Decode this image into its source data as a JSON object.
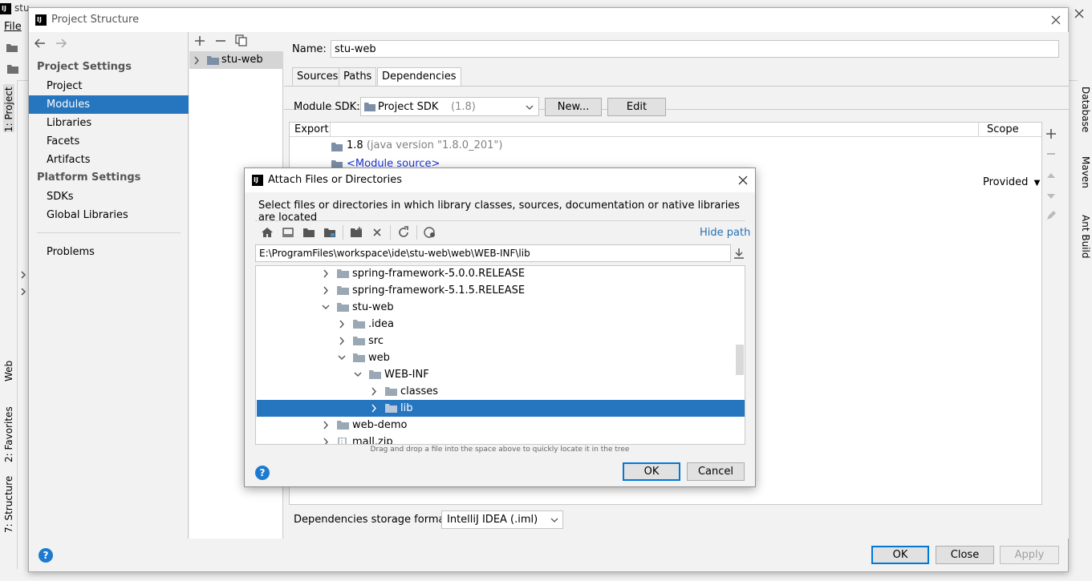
{
  "ide": {
    "title_fragment": "stu",
    "menu_file": "File",
    "left_tabs": [
      "1: Project",
      "Web",
      "2: Favorites",
      "7: Structure"
    ],
    "right_tabs": [
      "Database",
      "Maven",
      "Ant Build"
    ]
  },
  "project_structure": {
    "title": "Project Structure",
    "nav": {
      "project_settings_header": "Project Settings",
      "items_project": [
        "Project",
        "Modules",
        "Libraries",
        "Facets",
        "Artifacts"
      ],
      "platform_settings_header": "Platform Settings",
      "items_platform": [
        "SDKs",
        "Global Libraries"
      ],
      "problems": "Problems",
      "selected": "Modules"
    },
    "module_tree": {
      "item": "stu-web"
    },
    "name_label": "Name:",
    "name_value": "stu-web",
    "tabs": [
      "Sources",
      "Paths",
      "Dependencies"
    ],
    "selected_tab": "Dependencies",
    "module_sdk_label": "Module SDK:",
    "module_sdk_value": "Project SDK",
    "module_sdk_version": "(1.8)",
    "new_button": "New...",
    "edit_button": "Edit",
    "table": {
      "col_export": "Export",
      "col_scope": "Scope",
      "rows": [
        {
          "name": "1.8",
          "detail": "(java version \"1.8.0_201\")"
        },
        {
          "name": "<Module source>",
          "detail": ""
        }
      ],
      "scope_value": "Provided"
    },
    "storage_label": "Dependencies storage format:",
    "storage_value": "IntelliJ IDEA (.iml)",
    "ok": "OK",
    "close": "Close",
    "apply": "Apply"
  },
  "attach_dialog": {
    "title": "Attach Files or Directories",
    "description": "Select files or directories in which library classes, sources, documentation or native libraries are located",
    "hide_path": "Hide path",
    "path": "E:\\ProgramFiles\\workspace\\ide\\stu-web\\web\\WEB-INF\\lib",
    "tree": [
      {
        "label": "spring-framework-5.0.0.RELEASE",
        "depth": 0,
        "expanded": false,
        "type": "folder"
      },
      {
        "label": "spring-framework-5.1.5.RELEASE",
        "depth": 0,
        "expanded": false,
        "type": "folder"
      },
      {
        "label": "stu-web",
        "depth": 0,
        "expanded": true,
        "type": "folder"
      },
      {
        "label": ".idea",
        "depth": 1,
        "expanded": false,
        "type": "folder"
      },
      {
        "label": "src",
        "depth": 1,
        "expanded": false,
        "type": "folder"
      },
      {
        "label": "web",
        "depth": 1,
        "expanded": true,
        "type": "folder"
      },
      {
        "label": "WEB-INF",
        "depth": 2,
        "expanded": true,
        "type": "folder"
      },
      {
        "label": "classes",
        "depth": 3,
        "expanded": false,
        "type": "folder"
      },
      {
        "label": "lib",
        "depth": 3,
        "expanded": false,
        "type": "folder",
        "selected": true
      },
      {
        "label": "web-demo",
        "depth": 0,
        "expanded": false,
        "type": "folder"
      },
      {
        "label": "mall.zip",
        "depth": 0,
        "expanded": false,
        "type": "zip"
      }
    ],
    "hint": "Drag and drop a file into the space above to quickly locate it in the tree",
    "ok": "OK",
    "cancel": "Cancel"
  },
  "colors": {
    "selection": "#2675bf",
    "link": "#2470b3",
    "help": "#1e7ad1"
  }
}
